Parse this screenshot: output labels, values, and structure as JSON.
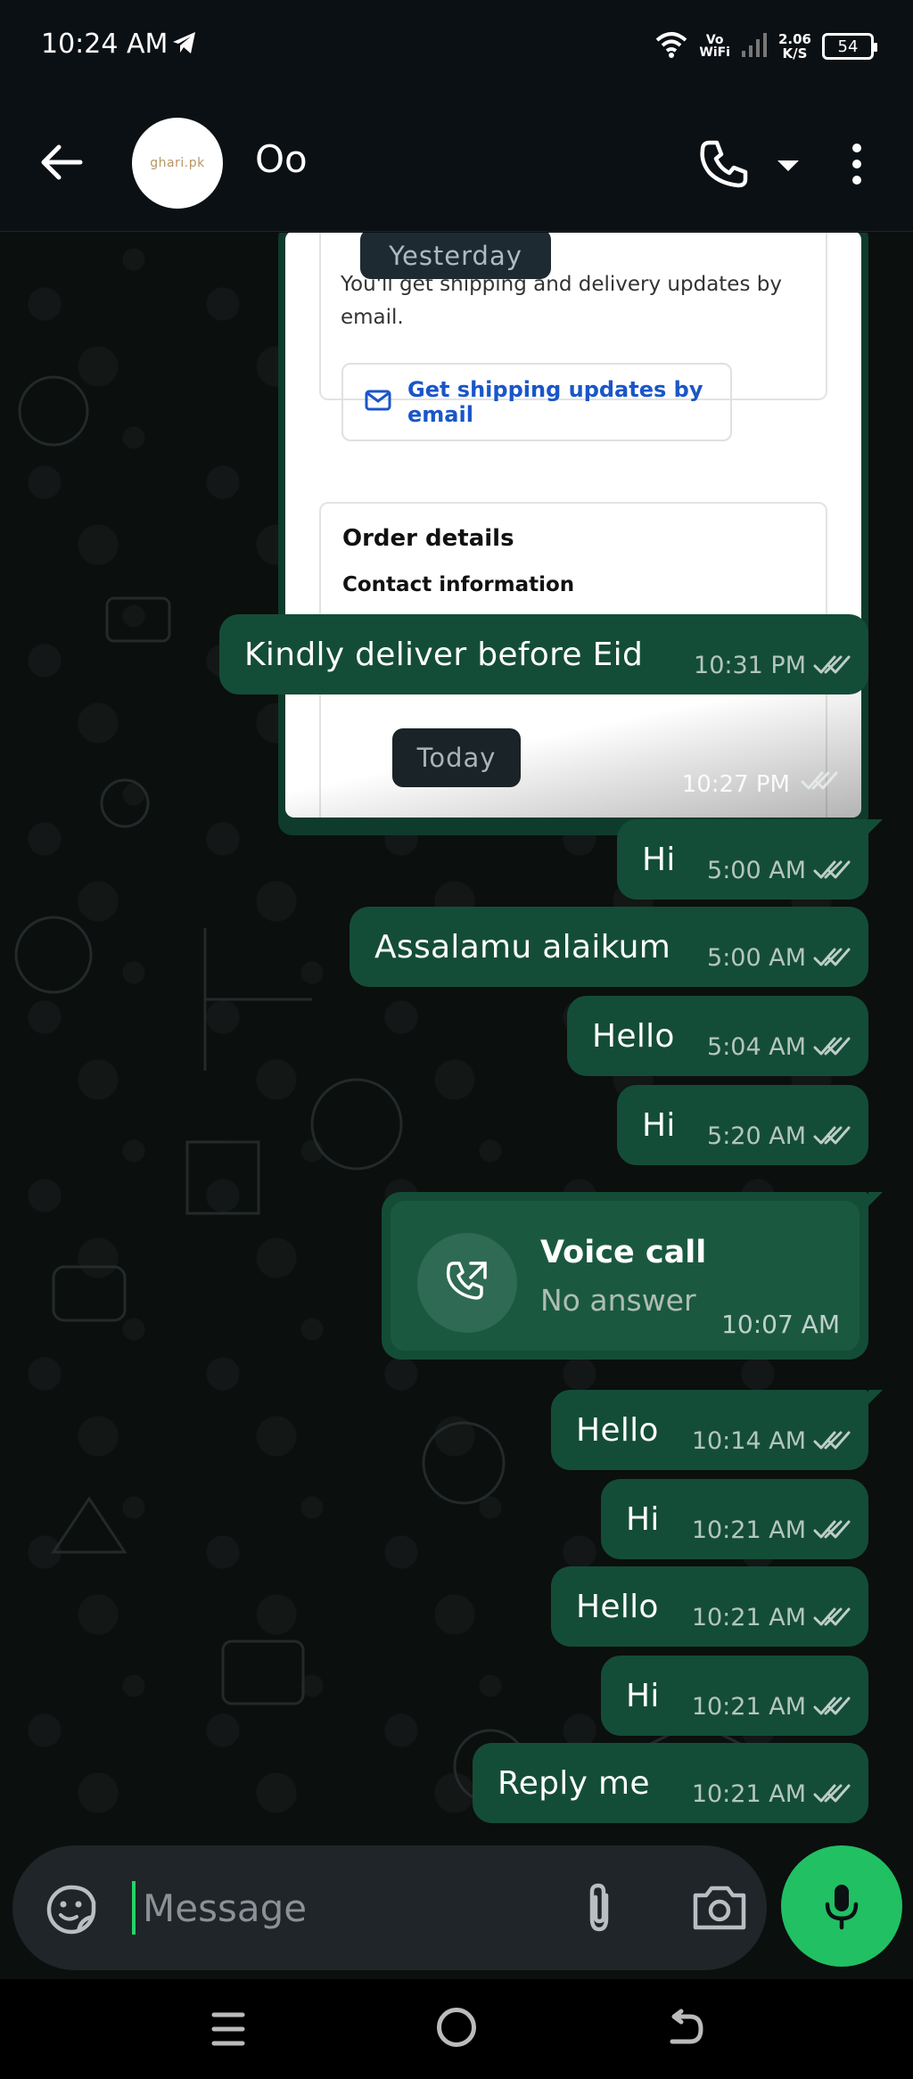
{
  "status_bar": {
    "time": "10:24 AM",
    "vo_label": "Vo",
    "wifi_label": "WiFi",
    "speed_value": "2.06",
    "speed_unit": "K/S",
    "battery": "54",
    "icons": [
      "telegram-icon",
      "wifi-icon",
      "signal-icon",
      "battery-icon"
    ]
  },
  "header": {
    "contact_name": "Oo",
    "avatar_text": "ghari.pk",
    "icons": [
      "back-arrow-icon",
      "phone-icon",
      "chevron-down-icon",
      "more-vert-icon"
    ]
  },
  "chat": {
    "image_message": {
      "ship_text": "You'll get shipping and delivery updates by email.",
      "email_button": "Get shipping updates by email",
      "order_details": "Order details",
      "contact_information": "Contact information",
      "time": "10:27 PM"
    },
    "date_chips": [
      "Yesterday",
      "Today"
    ],
    "messages": [
      {
        "text": "Kindly deliver before Eid",
        "time": "10:31 PM"
      },
      {
        "text": "Hi",
        "time": "5:00 AM"
      },
      {
        "text": "Assalamu alaikum",
        "time": "5:00 AM"
      },
      {
        "text": "Hello",
        "time": "5:04 AM"
      },
      {
        "text": "Hi",
        "time": "5:20 AM"
      },
      {
        "text": "Hello",
        "time": "10:14 AM"
      },
      {
        "text": "Hi",
        "time": "10:21 AM"
      },
      {
        "text": "Hello",
        "time": "10:21 AM"
      },
      {
        "text": "Hi",
        "time": "10:21 AM"
      },
      {
        "text": "Reply me",
        "time": "10:21 AM"
      }
    ],
    "call_message": {
      "title": "Voice call",
      "status": "No answer",
      "time": "10:07 AM"
    }
  },
  "composer": {
    "placeholder": "Message",
    "icons": [
      "sticker-icon",
      "paperclip-icon",
      "camera-icon",
      "mic-icon"
    ]
  },
  "colors": {
    "outgoing_bubble": "#144d37",
    "accent": "#21c063",
    "background": "#0b0f0e",
    "read_ticks": "#e9edef"
  }
}
